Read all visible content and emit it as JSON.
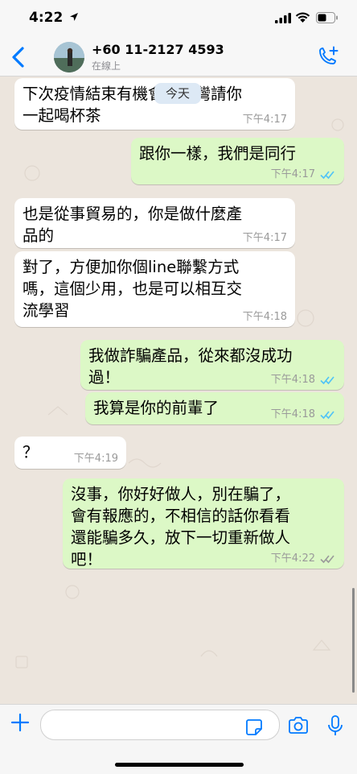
{
  "status_bar": {
    "time": "4:22",
    "location_icon": "location-arrow-icon"
  },
  "header": {
    "contact_name": "+60 11-2127 4593",
    "contact_status": "在線上",
    "back_icon": "chevron-left-icon",
    "call_icon": "add-call-icon"
  },
  "chat": {
    "day_chip": "今天",
    "messages": [
      {
        "direction": "in",
        "text": "下次疫情結束有機會來台灣請你\n一起喝杯茶",
        "time": "下午4:17"
      },
      {
        "direction": "out",
        "text": "跟你一樣，我們是同行",
        "time": "下午4:17",
        "status": "read"
      },
      {
        "direction": "in",
        "text": "也是從事貿易的，你是做什麼產\n品的",
        "time": "下午4:17"
      },
      {
        "direction": "in",
        "text": "對了，方便加你個line聯繫方式\n嗎，這個少用，也是可以相互交\n流學習",
        "time": "下午4:18"
      },
      {
        "direction": "out",
        "text": "我做詐騙產品，從來都沒成功\n過！",
        "time": "下午4:18",
        "status": "read"
      },
      {
        "direction": "out",
        "text": "我算是你的前輩了",
        "time": "下午4:18",
        "status": "read"
      },
      {
        "direction": "in",
        "text": "？",
        "time": "下午4:19"
      },
      {
        "direction": "out",
        "text": "沒事，你好好做人，別在騙了，\n會有報應的，不相信的話你看看\n還能騙多久，放下一切重新做人\n吧！",
        "time": "下午4:22",
        "status": "delivered"
      }
    ]
  },
  "input_bar": {
    "placeholder": ""
  },
  "colors": {
    "accent": "#007aff",
    "outgoing_bubble": "#dcf8c6",
    "incoming_bubble": "#ffffff",
    "read_ticks": "#4fc3f7"
  }
}
